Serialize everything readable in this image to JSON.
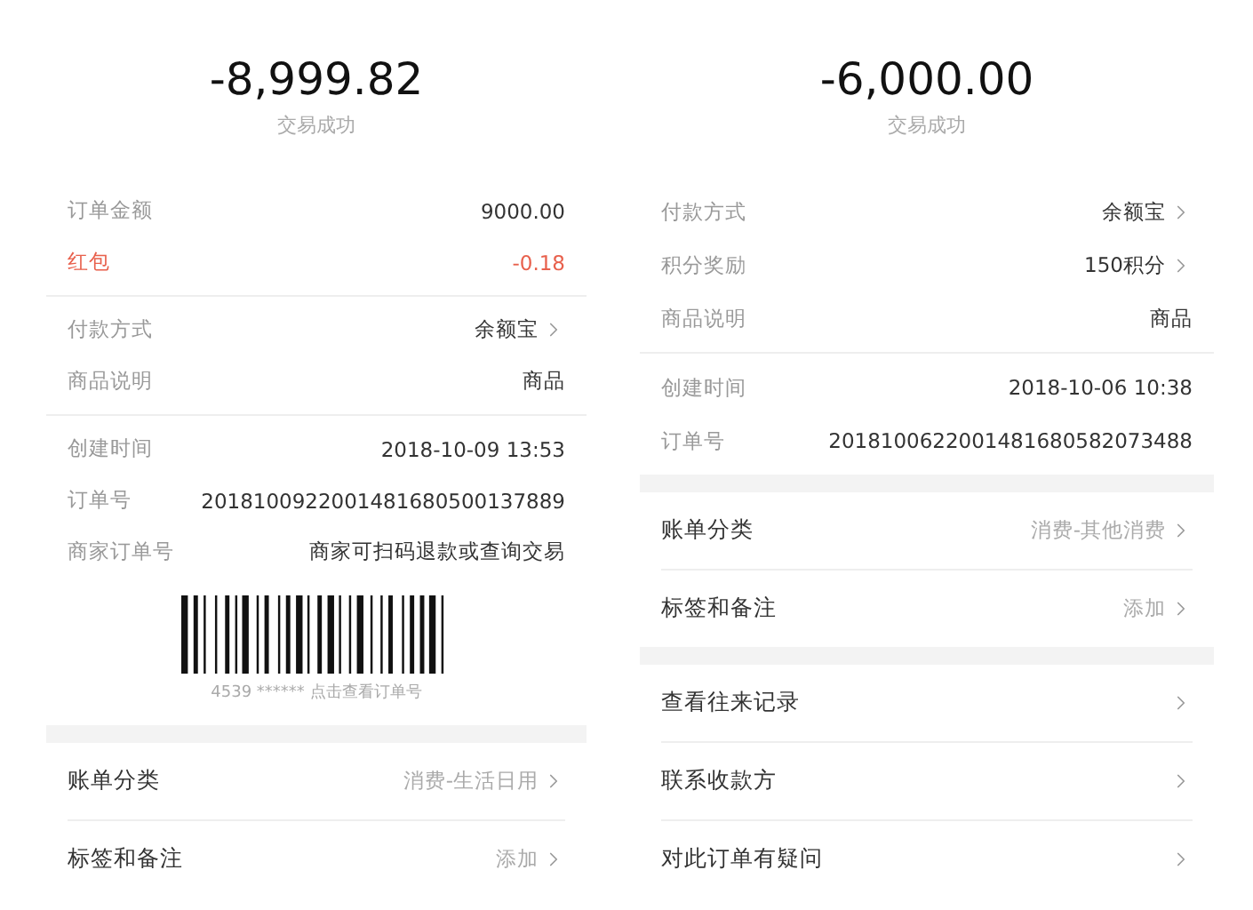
{
  "panels": [
    {
      "amount": "-8,999.82",
      "status": "交易成功",
      "sections": [
        {
          "kind": "details",
          "rows": [
            {
              "label": "订单金额",
              "value": "9000.00",
              "highlight": false,
              "link": false
            },
            {
              "label": "红包",
              "value": "-0.18",
              "highlight": true,
              "link": false
            }
          ]
        },
        {
          "kind": "details",
          "rows": [
            {
              "label": "付款方式",
              "value": "余额宝",
              "highlight": false,
              "link": true
            },
            {
              "label": "商品说明",
              "value": "商品",
              "highlight": false,
              "link": false
            }
          ]
        },
        {
          "kind": "details",
          "rows": [
            {
              "label": "创建时间",
              "value": "2018-10-09 13:53",
              "highlight": false,
              "link": false
            },
            {
              "label": "订单号",
              "value": "2018100922001481680500137889",
              "highlight": false,
              "link": false
            },
            {
              "label": "商家订单号",
              "value": "商家可扫码退款或查询交易",
              "highlight": false,
              "link": false
            }
          ],
          "barcode": {
            "caption": "4539 ****** 点击查看订单号"
          }
        },
        {
          "kind": "menu",
          "rows": [
            {
              "label": "账单分类",
              "value": "消费-生活日用"
            },
            {
              "label": "标签和备注",
              "value": "添加"
            }
          ]
        }
      ]
    },
    {
      "amount": "-6,000.00",
      "status": "交易成功",
      "sections": [
        {
          "kind": "details",
          "rows": [
            {
              "label": "付款方式",
              "value": "余额宝",
              "highlight": false,
              "link": true
            },
            {
              "label": "积分奖励",
              "value": "150积分",
              "highlight": false,
              "link": true
            },
            {
              "label": "商品说明",
              "value": "商品",
              "highlight": false,
              "link": false
            }
          ]
        },
        {
          "kind": "details",
          "rows": [
            {
              "label": "创建时间",
              "value": "2018-10-06 10:38",
              "highlight": false,
              "link": false
            },
            {
              "label": "订单号",
              "value": "2018100622001481680582073488",
              "highlight": false,
              "link": false
            }
          ]
        },
        {
          "kind": "menu",
          "rows": [
            {
              "label": "账单分类",
              "value": "消费-其他消费"
            },
            {
              "label": "标签和备注",
              "value": "添加"
            }
          ]
        },
        {
          "kind": "menu",
          "rows": [
            {
              "label": "查看往来记录"
            },
            {
              "label": "联系收款方"
            },
            {
              "label": "对此订单有疑问"
            }
          ]
        }
      ]
    }
  ]
}
